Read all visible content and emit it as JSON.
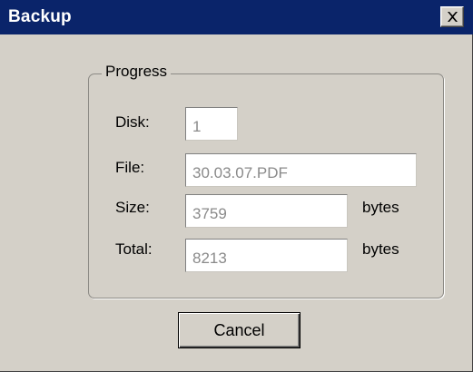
{
  "window": {
    "title": "Backup"
  },
  "progress": {
    "legend": "Progress",
    "disk": {
      "label": "Disk:",
      "value": "1"
    },
    "file": {
      "label": "File:",
      "value": "30.03.07.PDF"
    },
    "size": {
      "label": "Size:",
      "value": "3759",
      "unit": "bytes"
    },
    "total": {
      "label": "Total:",
      "value": "8213",
      "unit": "bytes"
    }
  },
  "buttons": {
    "cancel_label": "Cancel"
  },
  "icons": {
    "close": "close-icon"
  },
  "colors": {
    "titlebar": "#0a246a",
    "face": "#d4d0c8",
    "field_text": "#8a8a8a"
  }
}
